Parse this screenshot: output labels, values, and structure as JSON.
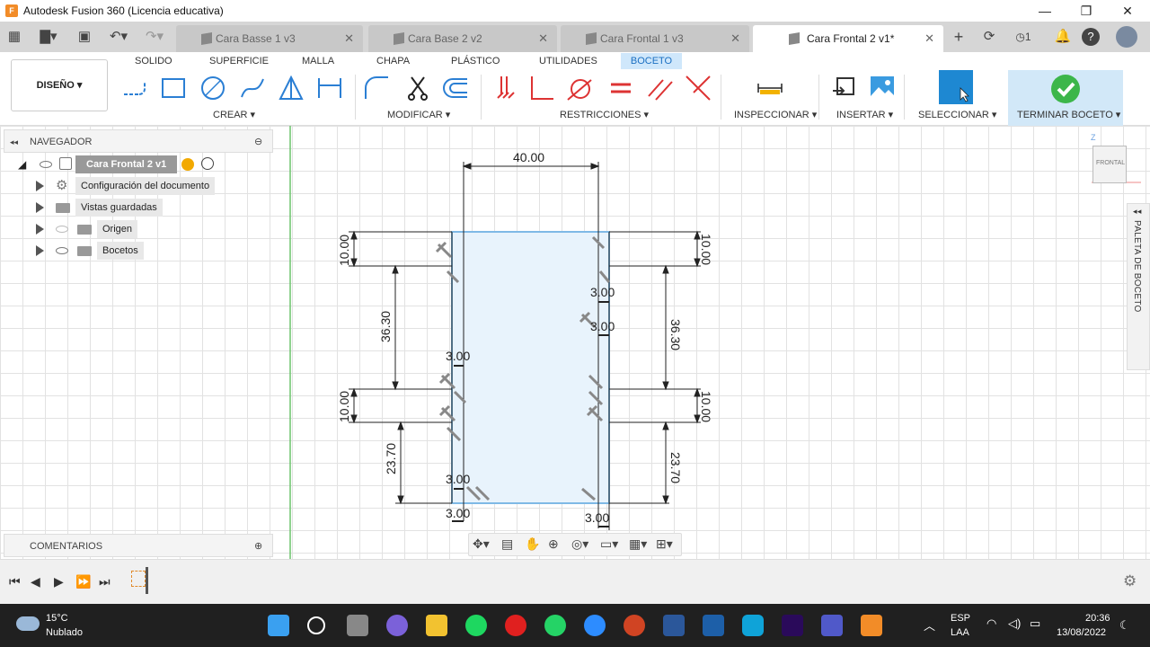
{
  "window": {
    "title": "Autodesk Fusion 360 (Licencia educativa)",
    "minimize": "—",
    "maximize": "❐",
    "close": "✕"
  },
  "tabs": [
    {
      "label": "Cara Basse 1 v3"
    },
    {
      "label": "Cara Base 2 v2"
    },
    {
      "label": "Cara Frontal 1 v3"
    },
    {
      "label": "Cara Frontal 2 v1*"
    }
  ],
  "tab_close": "✕",
  "tab_new": "+",
  "notification_count": "1",
  "ribbon": {
    "tabs": [
      "SOLIDO",
      "SUPERFICIE",
      "MALLA",
      "CHAPA",
      "PLÁSTICO",
      "UTILIDADES",
      "BOCETO"
    ],
    "active_tab": "BOCETO",
    "design_button": "DISEÑO ▾",
    "groups": {
      "create": "CREAR ▾",
      "modify": "MODIFICAR ▾",
      "constraints": "RESTRICCIONES ▾",
      "inspect": "INSPECCIONAR ▾",
      "insert": "INSERTAR ▾",
      "select": "SELECCIONAR ▾",
      "finish": "TERMINAR BOCETO ▾"
    },
    "colors": {
      "active_tab_bg": "#cfe7fb",
      "select_blue": "#1e88d2",
      "finish_green": "#3cb64a"
    }
  },
  "browser": {
    "title": "NAVEGADOR",
    "root": "Cara Frontal 2 v1",
    "items": [
      "Configuración del documento",
      "Vistas guardadas",
      "Origen",
      "Bocetos"
    ]
  },
  "comments": {
    "title": "COMENTARIOS"
  },
  "viewcube": {
    "label": "FRONTAL",
    "axis": "Z"
  },
  "palette": {
    "label": "PALETA DE BOCETO"
  },
  "sketch_dimensions": {
    "width_top": "40.00",
    "left": [
      "10.00",
      "36.30",
      "10.00",
      "23.70"
    ],
    "right": [
      "10.00",
      "36.30",
      "10.00",
      "23.70"
    ],
    "small": [
      "3.00",
      "3.00",
      "3.00",
      "3.00",
      "3.00",
      "3.00"
    ]
  },
  "taskbar": {
    "weather_temp": "15°C",
    "weather_desc": "Nublado",
    "lang_1": "ESP",
    "lang_2": "LAA",
    "time": "20:36",
    "date": "13/08/2022"
  }
}
